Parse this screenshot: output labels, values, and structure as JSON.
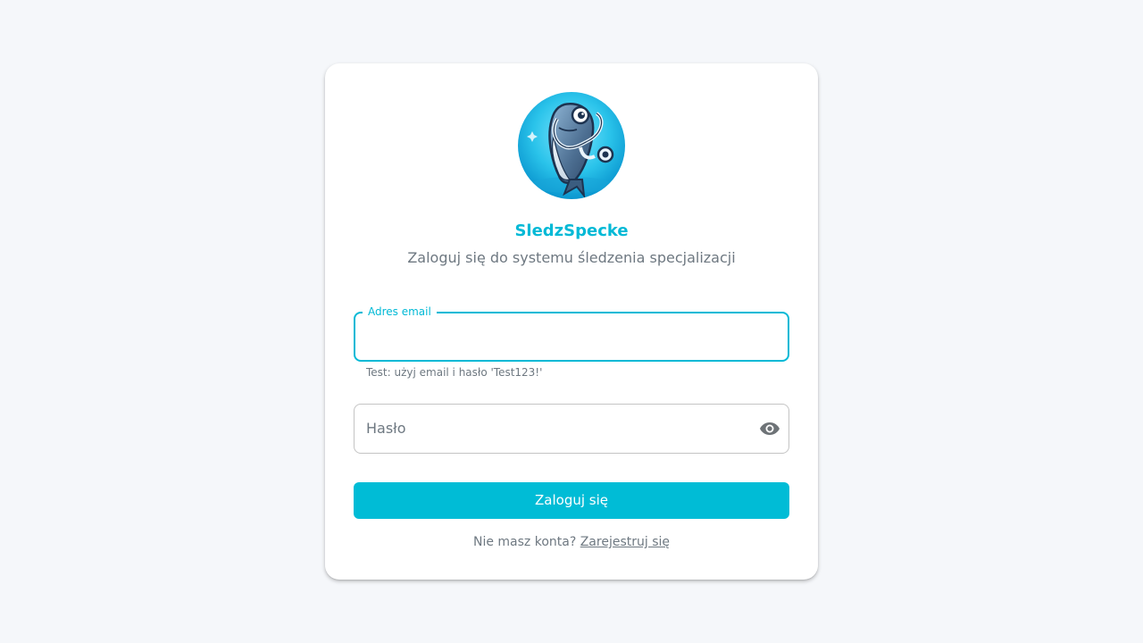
{
  "app": {
    "name": "SledzSpecke",
    "subtitle": "Zaloguj się do systemu śledzenia specjalizacji"
  },
  "form": {
    "email": {
      "label": "Adres email",
      "value": "",
      "helper": "Test: użyj email i hasło 'Test123!'"
    },
    "password": {
      "placeholder": "Hasło",
      "value": "",
      "toggle_icon": "eye-icon"
    },
    "submit_label": "Zaloguj się"
  },
  "register": {
    "prompt": "Nie masz konta?",
    "link_label": "Zarejestruj się"
  },
  "colors": {
    "accent": "#00b9d6",
    "muted_text": "#6e7881",
    "background": "#f5f7fa"
  }
}
